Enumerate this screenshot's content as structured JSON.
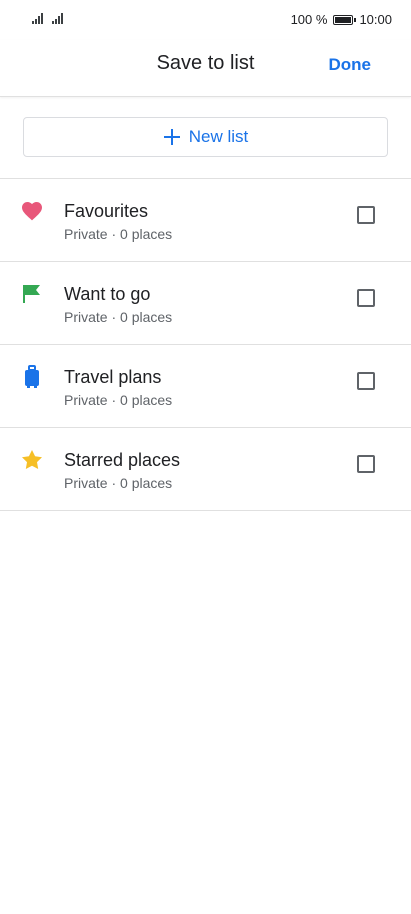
{
  "status_bar": {
    "battery": "100 %",
    "time": "10:00"
  },
  "header": {
    "title": "Save to list",
    "done_label": "Done"
  },
  "new_list": {
    "label": "New list"
  },
  "lists": [
    {
      "name": "Favourites",
      "meta": "Private · 0 places",
      "icon": "heart-icon",
      "color": "#e8577a",
      "checked": false
    },
    {
      "name": "Want to go",
      "meta": "Private · 0 places",
      "icon": "flag-icon",
      "color": "#34a853",
      "checked": false
    },
    {
      "name": "Travel plans",
      "meta": "Private · 0 places",
      "icon": "suitcase-icon",
      "color": "#1a73e8",
      "checked": false
    },
    {
      "name": "Starred places",
      "meta": "Private · 0 places",
      "icon": "star-icon",
      "color": "#f6bf26",
      "checked": false
    }
  ],
  "colors": {
    "accent": "#1a73e8",
    "divider": "#e0e0e0"
  }
}
